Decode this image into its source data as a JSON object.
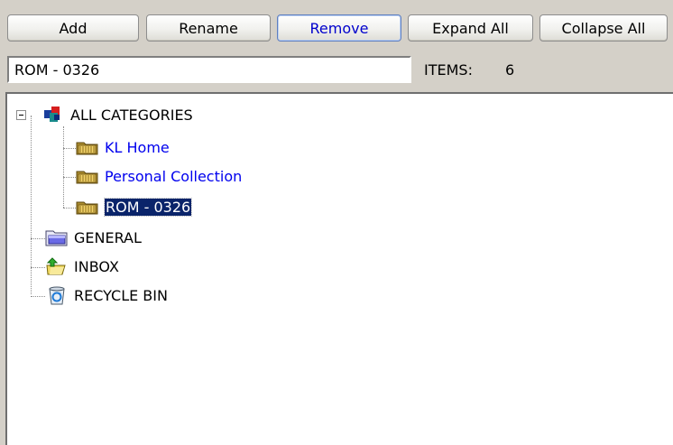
{
  "toolbar": {
    "add_label": "Add",
    "rename_label": "Rename",
    "remove_label": "Remove",
    "expand_all_label": "Expand All",
    "collapse_all_label": "Collapse All"
  },
  "name_field": {
    "value": "ROM - 0326"
  },
  "items": {
    "label": "ITEMS:",
    "count": "6"
  },
  "tree": {
    "root": {
      "label": "ALL CATEGORIES",
      "icon": "categories-icon",
      "expanded": true
    },
    "children": [
      {
        "label": "KL Home",
        "icon": "folder-icon"
      },
      {
        "label": "Personal Collection",
        "icon": "folder-icon"
      },
      {
        "label": "ROM - 0326",
        "icon": "folder-icon",
        "selected": true
      }
    ],
    "others": [
      {
        "label": "GENERAL",
        "icon": "blue-folder-icon"
      },
      {
        "label": "INBOX",
        "icon": "inbox-icon"
      },
      {
        "label": "RECYCLE BIN",
        "icon": "recycle-bin-icon"
      }
    ]
  },
  "colors": {
    "link": "#0000ee",
    "selection": "#0a246a",
    "background": "#d4d0c8"
  }
}
